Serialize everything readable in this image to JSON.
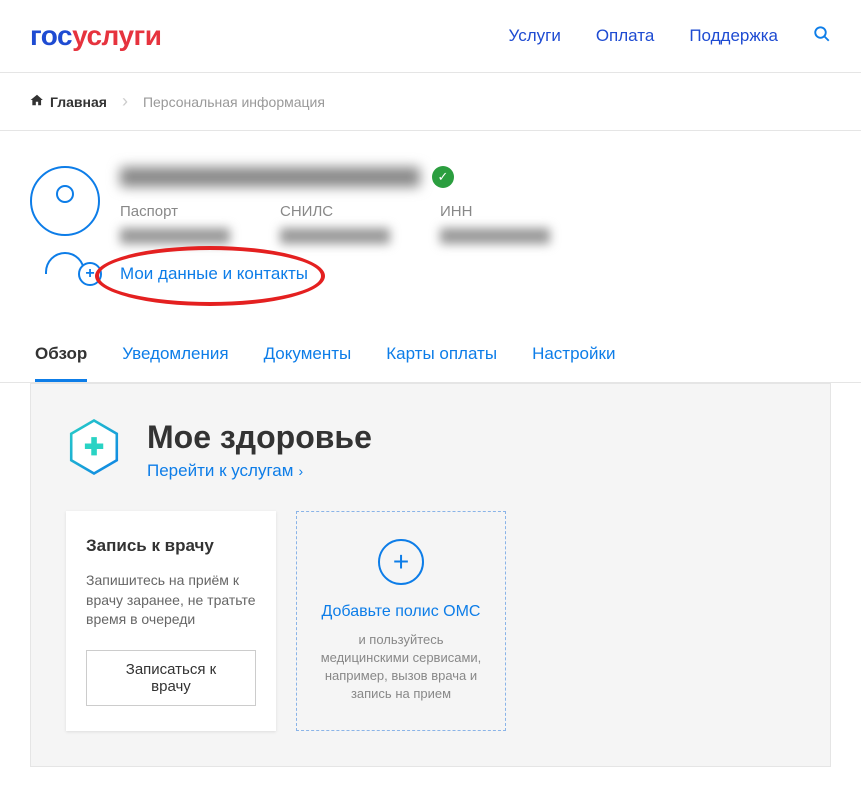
{
  "header": {
    "logo_gos": "гос",
    "logo_uslugi": "услуги",
    "nav": [
      "Услуги",
      "Оплата",
      "Поддержка"
    ]
  },
  "breadcrumb": {
    "home": "Главная",
    "current": "Персональная информация"
  },
  "profile": {
    "docs": {
      "passport_label": "Паспорт",
      "snils_label": "СНИЛС",
      "inn_label": "ИНН"
    },
    "my_data_link": "Мои данные и контакты"
  },
  "tabs": [
    "Обзор",
    "Уведомления",
    "Документы",
    "Карты оплаты",
    "Настройки"
  ],
  "health": {
    "title": "Мое здоровье",
    "services_link": "Перейти к услугам"
  },
  "cards": {
    "doctor": {
      "title": "Запись к врачу",
      "desc": "Запишитесь на приём к врачу заранее, не тратьте время в очереди",
      "button": "Записаться к врачу"
    },
    "oms": {
      "title": "Добавьте полис ОМС",
      "desc": "и пользуйтесь медицинскими сервисами, например, вызов врача и запись на прием"
    }
  }
}
